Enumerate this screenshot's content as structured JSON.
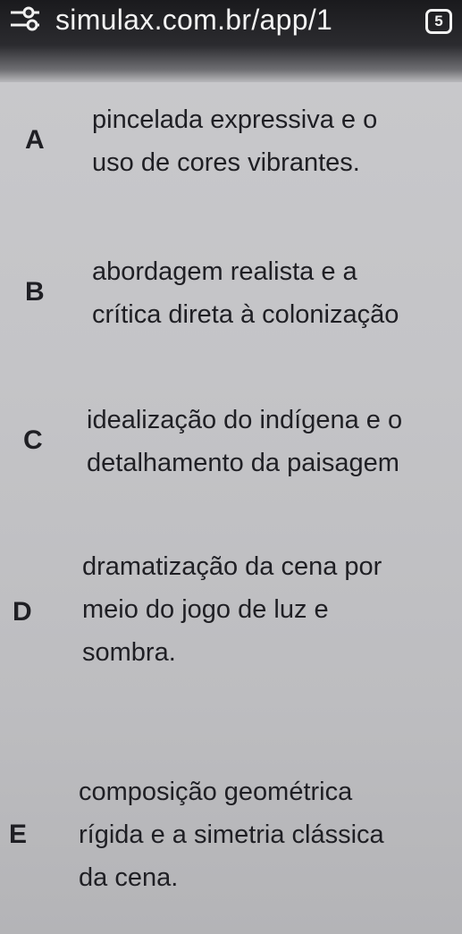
{
  "browser": {
    "url": "simulax.com.br/app/1",
    "tab_count": "5",
    "filter_icon": "sliders-icon",
    "tab_icon": "tab-switcher-icon"
  },
  "options": [
    {
      "letter": "A",
      "lines": [
        "pincelada expressiva e o",
        "uso de cores vibrantes."
      ]
    },
    {
      "letter": "B",
      "lines": [
        "abordagem realista e a",
        "crítica direta à colonização"
      ]
    },
    {
      "letter": "C",
      "lines": [
        "idealização do indígena e o",
        "detalhamento da paisagem"
      ]
    },
    {
      "letter": "D",
      "lines": [
        "dramatização da cena por",
        "meio do jogo de luz e",
        "sombra."
      ]
    },
    {
      "letter": "E",
      "lines": [
        "composição geométrica",
        "rígida e a simetria clássica",
        "da cena."
      ]
    }
  ]
}
